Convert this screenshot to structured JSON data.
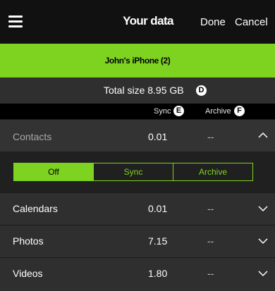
{
  "header": {
    "title": "Your data",
    "done_label": "Done",
    "cancel_label": "Cancel"
  },
  "device": {
    "name": "John's iPhone (2)"
  },
  "summary": {
    "total_size": "Total size 8.95 GB",
    "badge_d": "D"
  },
  "columns": {
    "sync": "Sync",
    "archive": "Archive",
    "badge_e": "E",
    "badge_f": "F"
  },
  "rows": [
    {
      "name": "Contacts",
      "sync": "0.01",
      "archive": "--",
      "expanded": true
    },
    {
      "name": "Calendars",
      "sync": "0.01",
      "archive": "--",
      "expanded": false
    },
    {
      "name": "Photos",
      "sync": "7.15",
      "archive": "--",
      "expanded": false
    },
    {
      "name": "Videos",
      "sync": "1.80",
      "archive": "--",
      "expanded": false
    }
  ],
  "segment": {
    "options": [
      "Off",
      "Sync",
      "Archive"
    ],
    "selected": "Off"
  },
  "colors": {
    "accent": "#7ed321",
    "background": "#2b2b2b",
    "topbar": "#111111"
  }
}
